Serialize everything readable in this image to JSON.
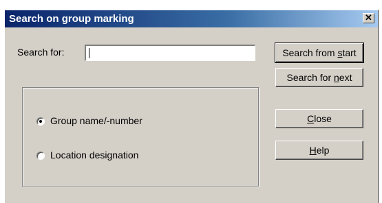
{
  "window": {
    "title": "Search on group marking",
    "close_glyph": "✕"
  },
  "search": {
    "label": "Search for:",
    "value": ""
  },
  "options": {
    "group_name": {
      "label": "Group name/-number",
      "selected": true
    },
    "location": {
      "label": "Location designation",
      "selected": false
    }
  },
  "buttons": {
    "search_from_start": {
      "before": "Search from ",
      "mnemonic": "s",
      "after": "tart"
    },
    "search_for_next": {
      "before": "Search for ",
      "mnemonic": "n",
      "after": "ext"
    },
    "close": {
      "before": "",
      "mnemonic": "C",
      "after": "lose"
    },
    "help": {
      "before": "",
      "mnemonic": "H",
      "after": "elp"
    }
  },
  "colors": {
    "dialog_face": "#d4d0c8",
    "titlebar_start": "#0a246a",
    "titlebar_end": "#a6caf0"
  }
}
